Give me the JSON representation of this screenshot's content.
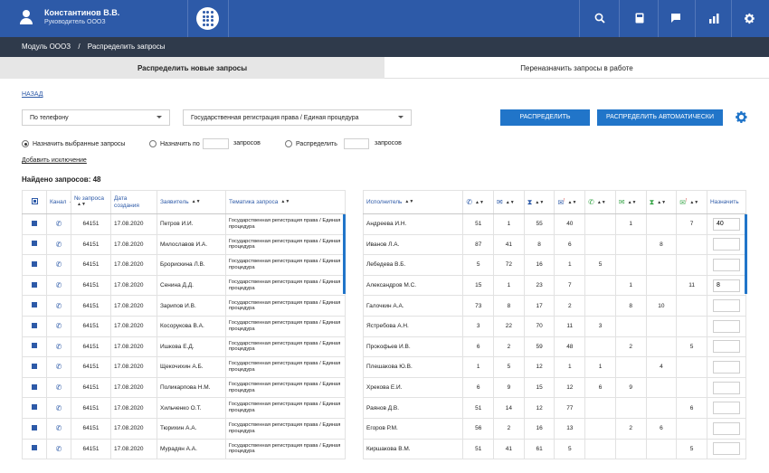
{
  "header": {
    "user_name": "Константинов В.В.",
    "user_role": "Руководитель ОООЗ",
    "icons": [
      "search-icon",
      "book-icon",
      "chat-icon",
      "chart-icon",
      "gear-icon"
    ]
  },
  "breadcrumb": {
    "module": "Модуль ОООЗ",
    "separator": "/",
    "current": "Распределить запросы"
  },
  "tabs": {
    "active": "Распределить новые запросы",
    "other": "Переназначить запросы в работе"
  },
  "back_link": "НАЗАД",
  "filters": {
    "by_phone": "По телефону",
    "service": "Государственная регистрация права / Единая процедура"
  },
  "buttons": {
    "distribute": "РАСПРЕДЕЛИТЬ",
    "distribute_auto": "РАСПРЕДЕЛИТЬ АВТОМАТИЧЕСКИ"
  },
  "radios": {
    "assign_selected": "Назначить выбранные запросы",
    "assign_by": "Назначить по",
    "requests1": "запросов",
    "distribute": "Распределить",
    "requests2": "запросов"
  },
  "add_exception": "Добавить исключение",
  "found_label": "Найдено запросов: 48",
  "left_table": {
    "headers": {
      "channel": "Канал",
      "num": "№ запроса",
      "date": "Дата создания",
      "applicant": "Заявитель",
      "topic": "Тематика запроса"
    },
    "rows": [
      {
        "num": "64151",
        "date": "17.08.2020",
        "applicant": "Петров И.И.",
        "topic": "Государственная регистрация права / Единая процедура"
      },
      {
        "num": "64151",
        "date": "17.08.2020",
        "applicant": "Милославов И.А.",
        "topic": "Государственная регистрация права / Единая процедура"
      },
      {
        "num": "64151",
        "date": "17.08.2020",
        "applicant": "Брорискина Л.В.",
        "topic": "Государственная регистрация права / Единая процедура"
      },
      {
        "num": "64151",
        "date": "17.08.2020",
        "applicant": "Сенина Д.Д.",
        "topic": "Государственная регистрация права / Единая процедура"
      },
      {
        "num": "64151",
        "date": "17.08.2020",
        "applicant": "Зарипов И.В.",
        "topic": "Государственная регистрация права / Единая процедура"
      },
      {
        "num": "64151",
        "date": "17.08.2020",
        "applicant": "Косорукова В.А.",
        "topic": "Государственная регистрация права / Единая процедура"
      },
      {
        "num": "64151",
        "date": "17.08.2020",
        "applicant": "Ишкова Е.Д.",
        "topic": "Государственная регистрация права / Единая процедура"
      },
      {
        "num": "64151",
        "date": "17.08.2020",
        "applicant": "Щекочихин А.Б.",
        "topic": "Государственная регистрация права / Единая процедура"
      },
      {
        "num": "64151",
        "date": "17.08.2020",
        "applicant": "Поликарпова Н.М.",
        "topic": "Государственная регистрация права / Единая процедура"
      },
      {
        "num": "64151",
        "date": "17.08.2020",
        "applicant": "Хильченко О.Т.",
        "topic": "Государственная регистрация права / Единая процедура"
      },
      {
        "num": "64151",
        "date": "17.08.2020",
        "applicant": "Тюрихин А.А.",
        "topic": "Государственная регистрация права / Единая процедура"
      },
      {
        "num": "64151",
        "date": "17.08.2020",
        "applicant": "Мурадян А.А.",
        "topic": "Государственная регистрация права / Единая процедура"
      }
    ]
  },
  "right_table": {
    "headers": {
      "executor": "Исполнитель",
      "assign": "Назначить"
    },
    "rows": [
      {
        "name": "Андреева И.Н.",
        "v": [
          "51",
          "1",
          "55",
          "40",
          "",
          "1",
          "",
          "7"
        ],
        "assign": "40"
      },
      {
        "name": "Иванов Л.А.",
        "v": [
          "87",
          "41",
          "8",
          "6",
          "",
          "",
          "8",
          ""
        ],
        "assign": ""
      },
      {
        "name": "Лебедева В.Б.",
        "v": [
          "5",
          "72",
          "16",
          "1",
          "5",
          "",
          "",
          ""
        ],
        "assign": ""
      },
      {
        "name": "Александров М.С.",
        "v": [
          "15",
          "1",
          "23",
          "7",
          "",
          "1",
          "",
          "11"
        ],
        "assign": "8"
      },
      {
        "name": "Галочкин А.А.",
        "v": [
          "73",
          "8",
          "17",
          "2",
          "",
          "8",
          "10",
          ""
        ],
        "assign": ""
      },
      {
        "name": "Ястребова А.Н.",
        "v": [
          "3",
          "22",
          "70",
          "11",
          "3",
          "",
          "",
          ""
        ],
        "assign": ""
      },
      {
        "name": "Прокофьев И.В.",
        "v": [
          "6",
          "2",
          "59",
          "48",
          "",
          "2",
          "",
          "5"
        ],
        "assign": ""
      },
      {
        "name": "Плешакова Ю.В.",
        "v": [
          "1",
          "5",
          "12",
          "1",
          "1",
          "",
          "4",
          ""
        ],
        "assign": ""
      },
      {
        "name": "Хрекова Е.И.",
        "v": [
          "6",
          "9",
          "15",
          "12",
          "6",
          "9",
          "",
          ""
        ],
        "assign": ""
      },
      {
        "name": "Раянов Д.В.",
        "v": [
          "51",
          "14",
          "12",
          "77",
          "",
          "",
          "",
          "6"
        ],
        "assign": ""
      },
      {
        "name": "Егоров Р.М.",
        "v": [
          "56",
          "2",
          "16",
          "13",
          "",
          "2",
          "6",
          ""
        ],
        "assign": ""
      },
      {
        "name": "Киршакова В.М.",
        "v": [
          "51",
          "41",
          "61",
          "5",
          "",
          "",
          "",
          "5"
        ],
        "assign": ""
      }
    ]
  },
  "colors": {
    "primary": "#2d5aa8",
    "dark": "#2f3a4b",
    "button": "#2175c9",
    "green": "#3aa64a"
  }
}
